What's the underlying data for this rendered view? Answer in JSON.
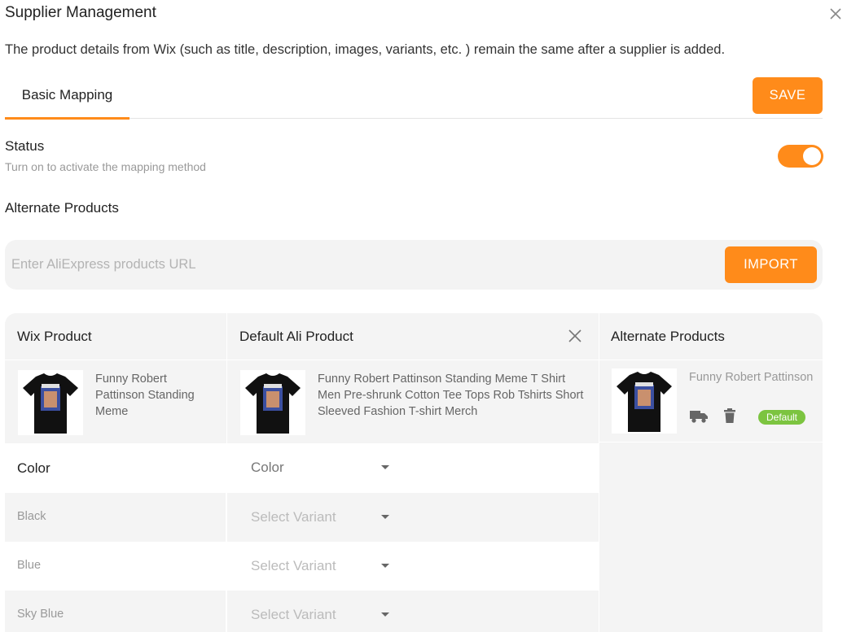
{
  "dialog": {
    "title": "Supplier Management",
    "description": "The product details from Wix (such as title, description, images, variants, etc. ) remain the same after a supplier is added."
  },
  "tabs": [
    {
      "label": "Basic Mapping",
      "active": true
    }
  ],
  "toolbar": {
    "save_label": "SAVE"
  },
  "status": {
    "label": "Status",
    "sublabel": "Turn on to activate the mapping method",
    "enabled": true
  },
  "alternate": {
    "label": "Alternate Products",
    "url_placeholder": "Enter AliExpress products URL",
    "import_label": "IMPORT"
  },
  "table": {
    "headers": {
      "wix": "Wix Product",
      "ali": "Default Ali Product",
      "alt": "Alternate Products"
    },
    "wix_product": {
      "title": "Funny Robert Pattinson Standing Meme"
    },
    "ali_product": {
      "title": "Funny Robert Pattinson Standing Meme T Shirt Men Pre-shrunk Cotton Tee Tops Rob Tshirts Short Sleeved Fashion T-shirt Merch"
    },
    "alt_product": {
      "title": "Funny Robert Pattinson Standing ...",
      "badge": "Default"
    },
    "option": {
      "name": "Color",
      "selected": "Color"
    },
    "variants": [
      {
        "name": "Black",
        "select": "Select Variant"
      },
      {
        "name": "Blue",
        "select": "Select Variant"
      },
      {
        "name": "Sky Blue",
        "select": "Select Variant"
      }
    ]
  },
  "colors": {
    "accent": "#ff8b1a",
    "badge": "#7cc440",
    "row_bg": "#f4f4f4"
  },
  "icons": [
    "close-icon",
    "truck-icon",
    "trash-icon",
    "chevron-down-icon"
  ]
}
